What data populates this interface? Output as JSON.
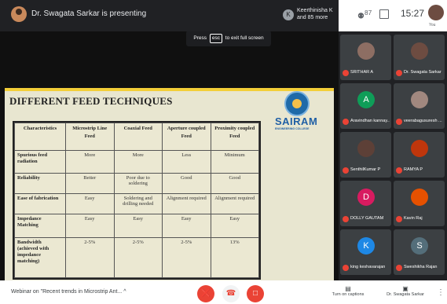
{
  "header": {
    "presenter_text": "Dr. Swagata Sarkar is presenting",
    "viewer_initial": "K",
    "viewers_line1": "Keerthinisha K",
    "viewers_line2": "and 85 more",
    "participant_count": "87",
    "clock": "15:27",
    "you_label": "You"
  },
  "esc_hint": {
    "pre": "Press",
    "key": "esc",
    "post": "to exit full screen"
  },
  "slide": {
    "title": "DIFFERENT FEED TECHNIQUES",
    "logo_text": "SAIRAM",
    "logo_sub": "ENGINEERING COLLEGE",
    "table": {
      "headers": [
        "Characteristics",
        "Microstrip Line Feed",
        "Coaxial Feed",
        "Aperture coupled Feed",
        "Proximity coupled Feed"
      ],
      "rows": [
        [
          "Spurious feed radiation",
          "More",
          "More",
          "Less",
          "Minimum"
        ],
        [
          "Reliability",
          "Better",
          "Poor due to soldering",
          "Good",
          "Good"
        ],
        [
          "Ease of fabrication",
          "Easy",
          "Soldering and drilling needed",
          "Alignment required",
          "Alignment required"
        ],
        [
          "Impedance Matching",
          "Easy",
          "Easy",
          "Easy",
          "Easy"
        ],
        [
          "Bandwidth (achieved with impedance matching)",
          "2-5%",
          "2-5%",
          "2-5%",
          "13%"
        ]
      ]
    }
  },
  "participants": [
    {
      "name": "SRITHAR A",
      "initial": "",
      "color": "#8d6e63"
    },
    {
      "name": "Dr. Swagata Sarkar",
      "initial": "",
      "color": "#6d4c41"
    },
    {
      "name": "Aravindhan kannay...",
      "initial": "A",
      "color": "#0f9d58"
    },
    {
      "name": "veerabagusuresh ...",
      "initial": "",
      "color": "#a1887f"
    },
    {
      "name": "SenthilKumar P",
      "initial": "",
      "color": "#5d4037"
    },
    {
      "name": "RAMYA P",
      "initial": "",
      "color": "#bf360c"
    },
    {
      "name": "DOLLY GAUTAM",
      "initial": "D",
      "color": "#d81b60"
    },
    {
      "name": "Kavin Raj",
      "initial": "",
      "color": "#e65100"
    },
    {
      "name": "king keshavarajan",
      "initial": "K",
      "color": "#1e88e5"
    },
    {
      "name": "Sweshikha Rajan",
      "initial": "S",
      "color": "#546e7a"
    }
  ],
  "footer": {
    "meeting_title": "Webinar on \"Recent trends in Microstrip Ant...",
    "chevron": "^",
    "captions_label": "Turn on captions",
    "presenting_label": "Dr. Swagata Sarkar",
    "more": "⋮"
  }
}
